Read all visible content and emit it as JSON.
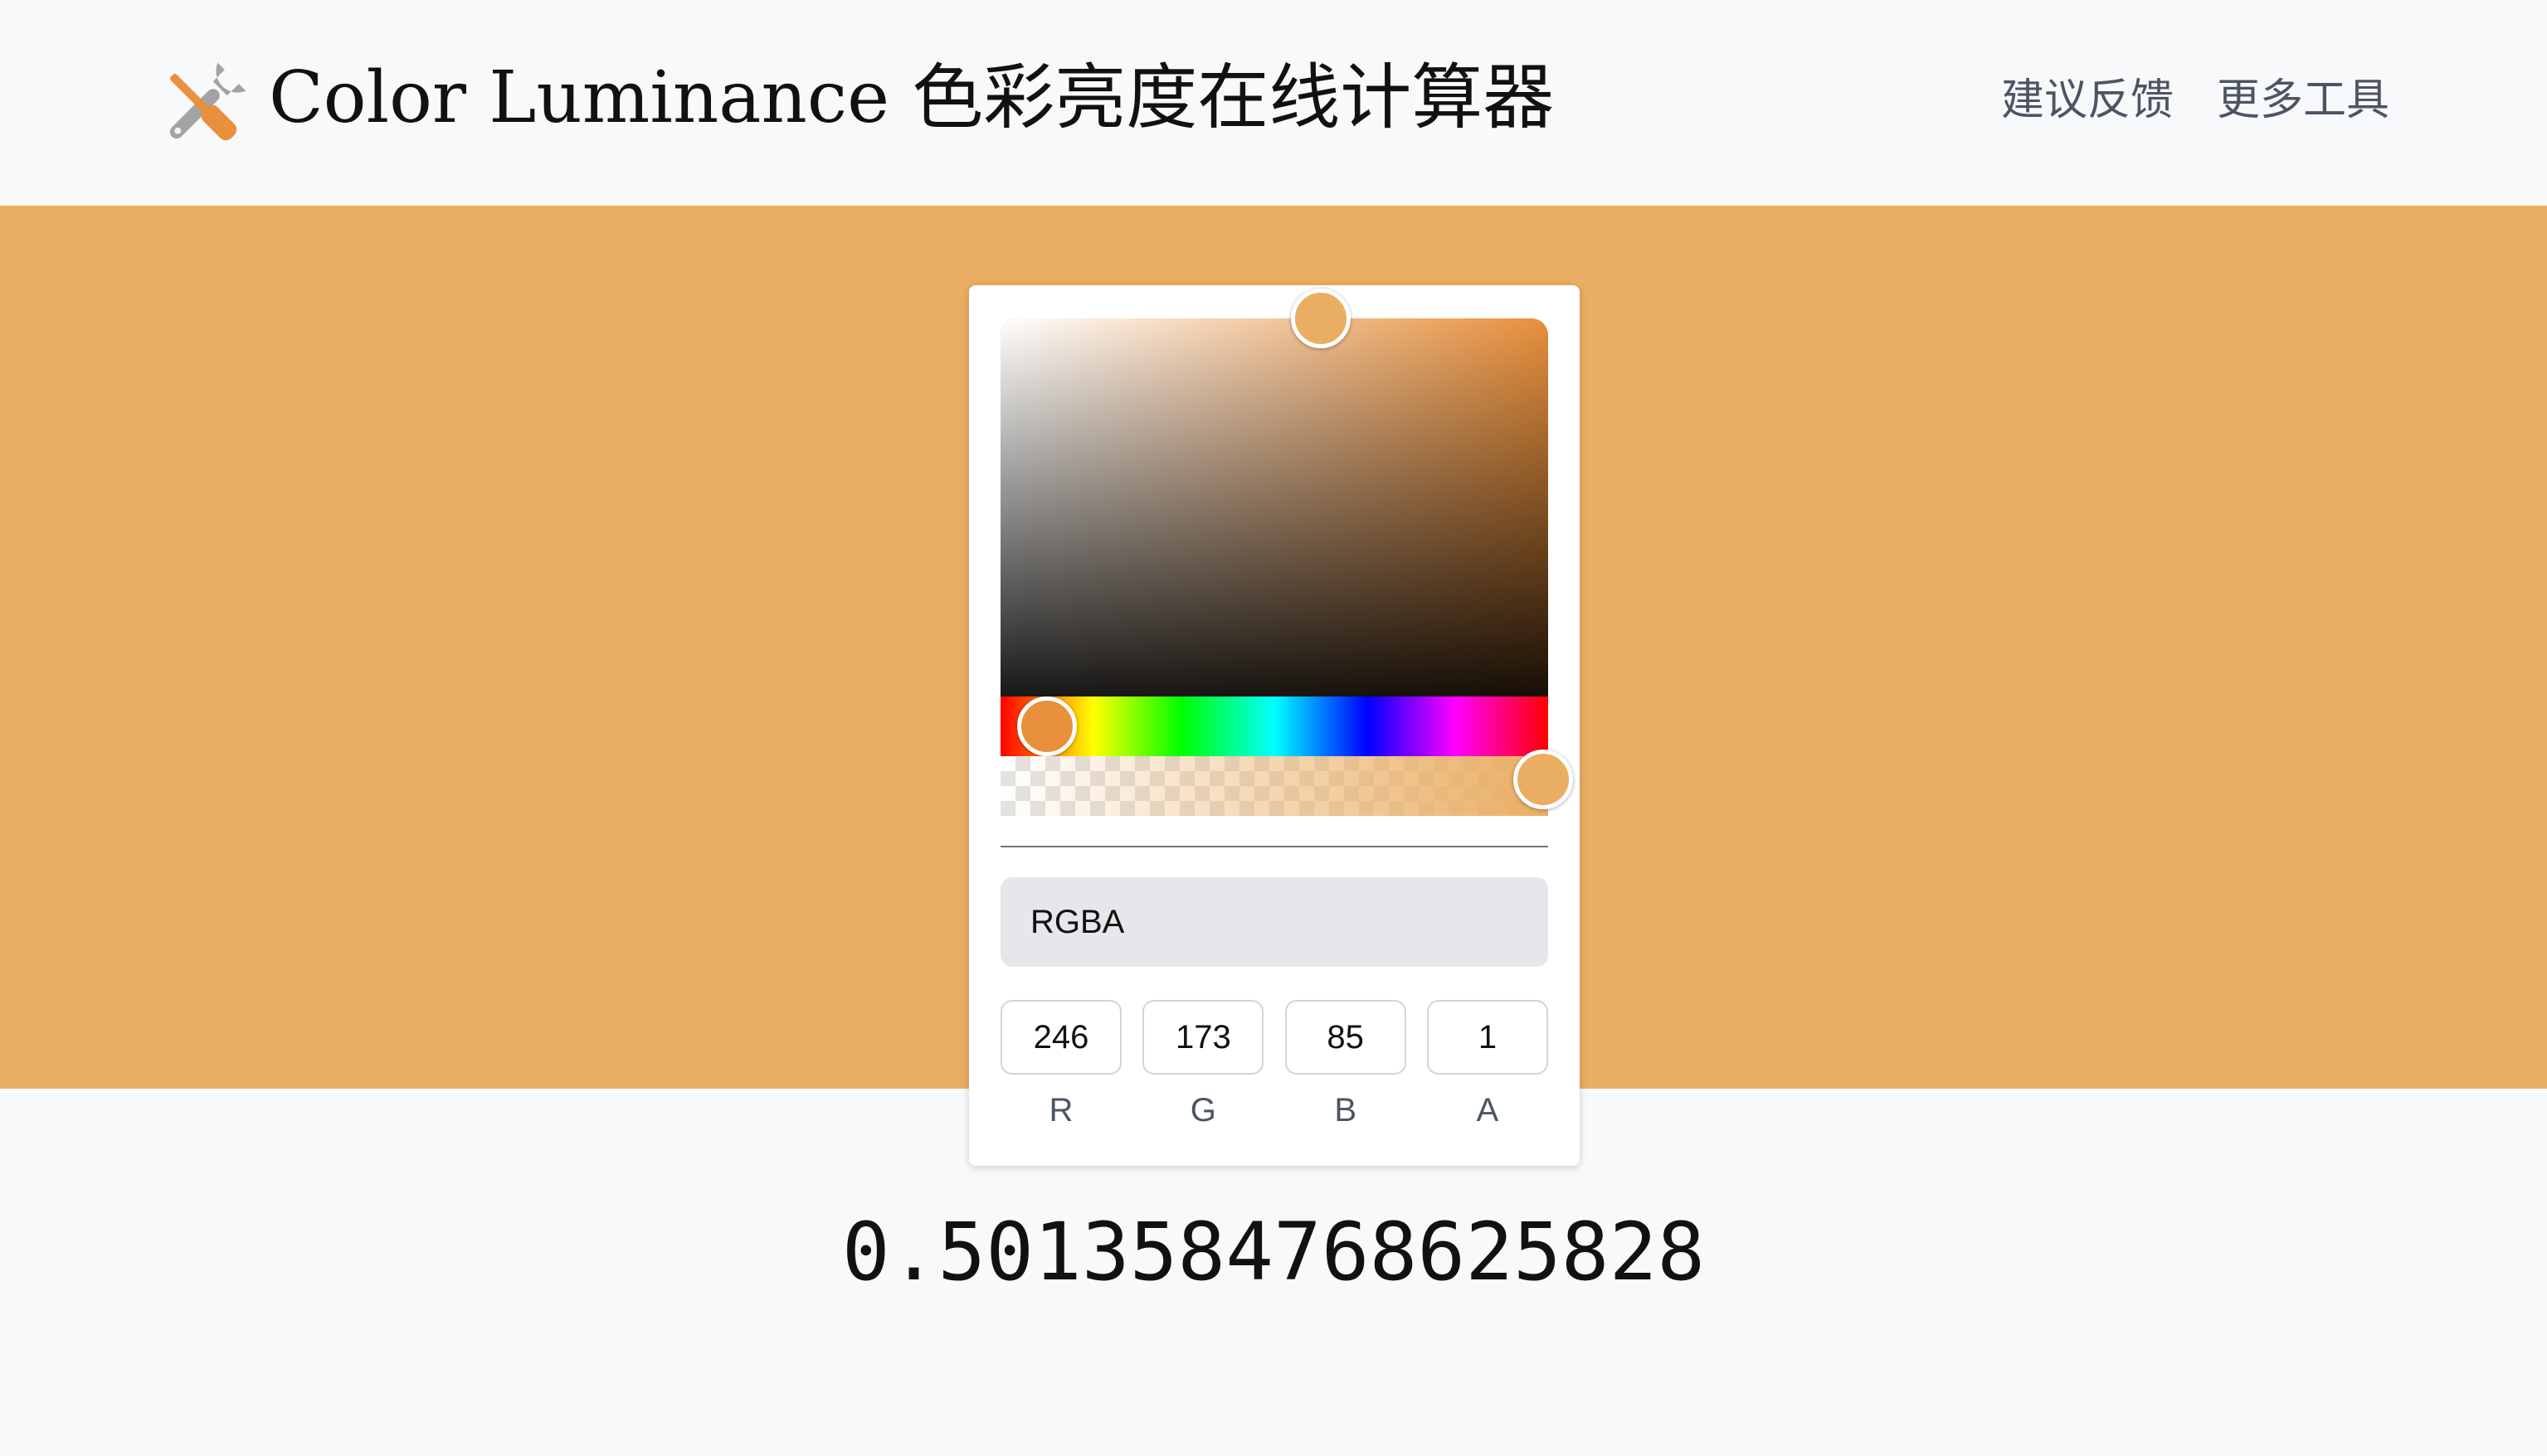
{
  "header": {
    "title": "Color Luminance 色彩亮度在线计算器",
    "logo_icon": "tools-icon",
    "nav": [
      {
        "label": "建议反馈"
      },
      {
        "label": "更多工具"
      }
    ]
  },
  "colors": {
    "selected": "#EAAE63",
    "hue": "#E8903C"
  },
  "picker": {
    "format_label": "RGBA",
    "channels": [
      {
        "value": "246",
        "label": "R"
      },
      {
        "value": "173",
        "label": "G"
      },
      {
        "value": "85",
        "label": "B"
      },
      {
        "value": "1",
        "label": "A"
      }
    ]
  },
  "result": {
    "luminance": "0.5013584768625828"
  }
}
